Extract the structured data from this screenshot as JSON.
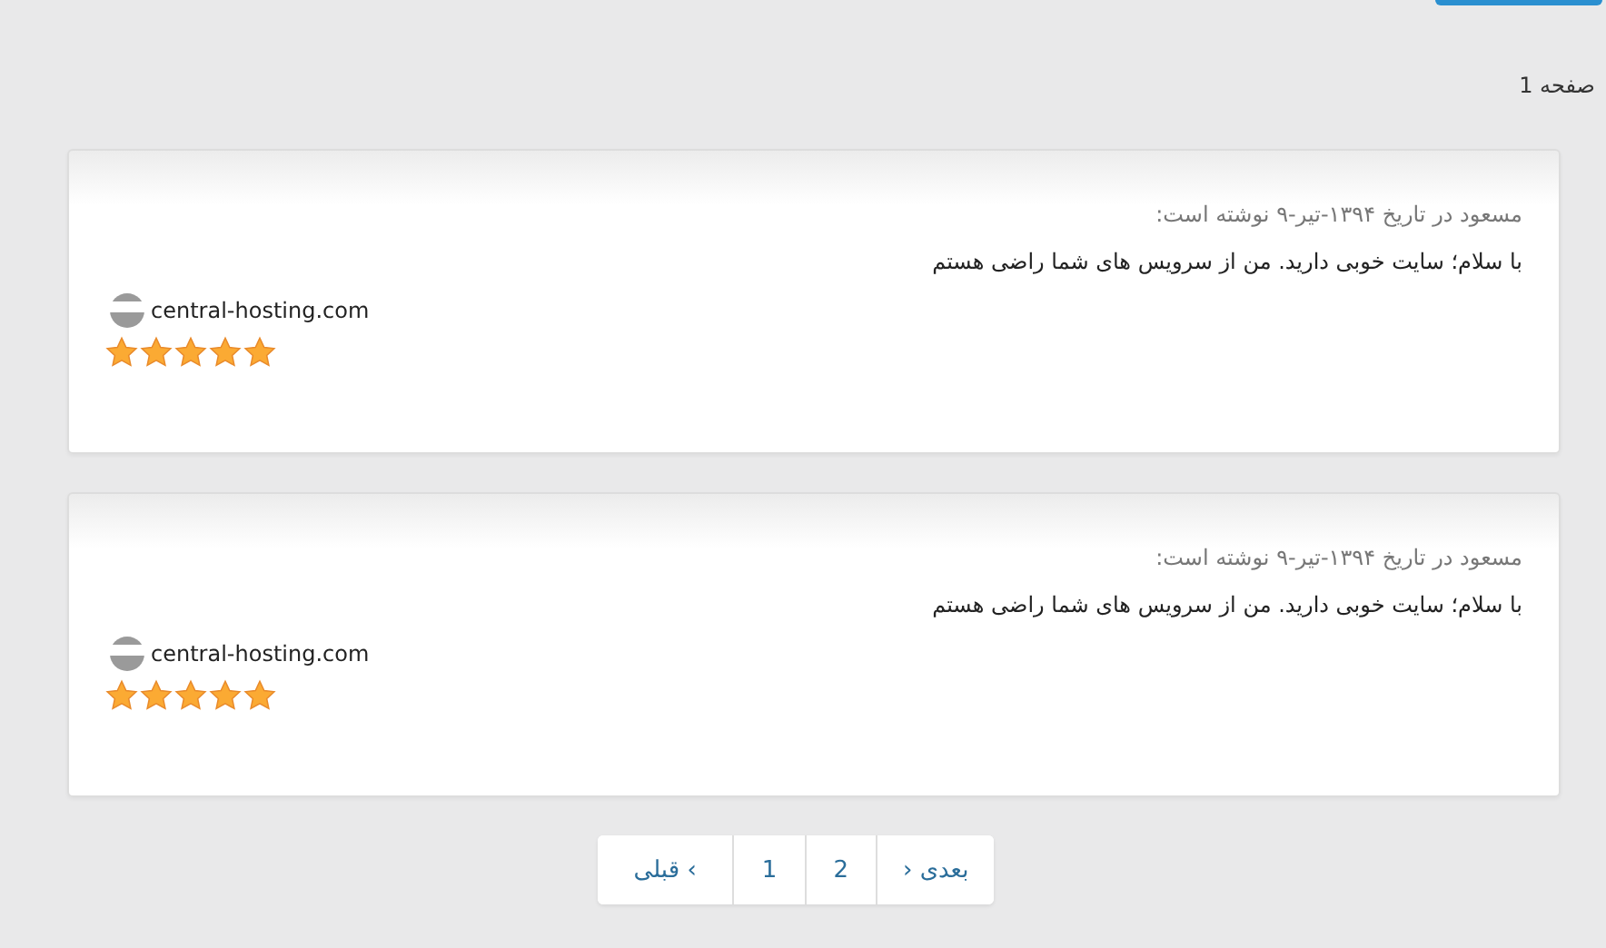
{
  "page_label": "صفحه 1",
  "reviews": [
    {
      "meta": "مسعود در تاریخ ۱۳۹۴-تیر-۹ نوشته است:",
      "comment": "با سلام؛ سایت خوبی دارید. من از سرویس های شما راضی هستم",
      "website": "central-hosting.com",
      "stars": 5
    },
    {
      "meta": "مسعود در تاریخ ۱۳۹۴-تیر-۹ نوشته است:",
      "comment": "با سلام؛ سایت خوبی دارید. من از سرویس های شما راضی هستم",
      "website": "central-hosting.com",
      "stars": 5
    }
  ],
  "pagination": [
    {
      "label": "› بعدی"
    },
    {
      "label": "2"
    },
    {
      "label": "1"
    },
    {
      "label": "قبلی ‹"
    }
  ]
}
